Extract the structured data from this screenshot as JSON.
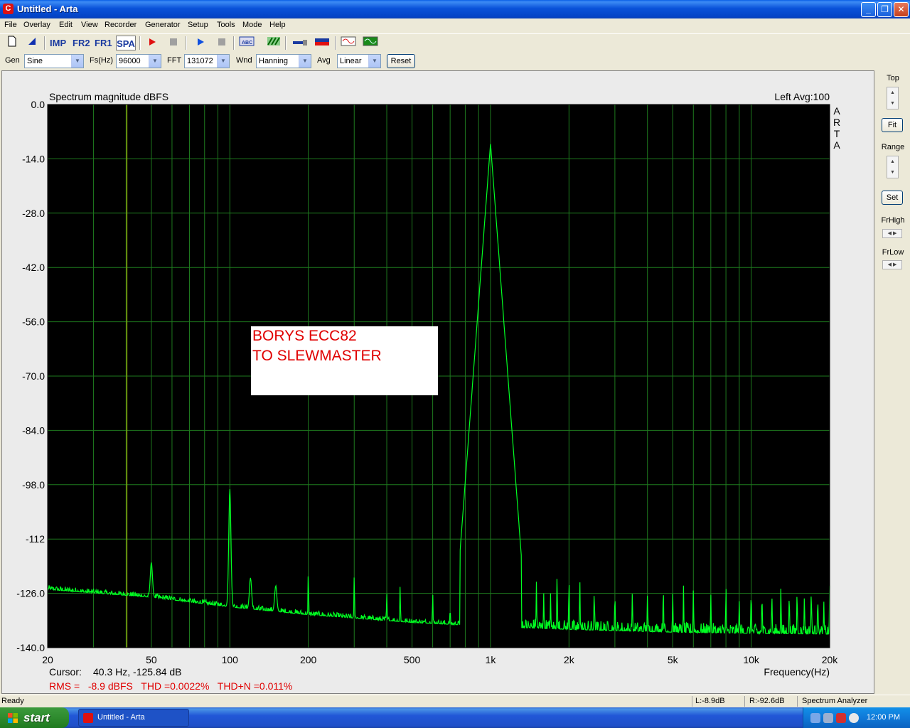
{
  "window": {
    "title": "Untitled - Arta",
    "icon": "arta-app-icon"
  },
  "menu": [
    "File",
    "Overlay",
    "Edit",
    "View",
    "Recorder",
    "Generator",
    "Setup",
    "Tools",
    "Mode",
    "Help"
  ],
  "toolbar": {
    "imp": "IMP",
    "fr2": "FR2",
    "fr1": "FR1",
    "spa": "SPA"
  },
  "controls": {
    "gen_label": "Gen",
    "gen_value": "Sine",
    "fs_label": "Fs(Hz)",
    "fs_value": "96000",
    "fft_label": "FFT",
    "fft_value": "131072",
    "wnd_label": "Wnd",
    "wnd_value": "Hanning",
    "avg_label": "Avg",
    "avg_value": "Linear",
    "reset_label": "Reset"
  },
  "side": {
    "top_label": "Top",
    "fit_label": "Fit",
    "range_label": "Range",
    "set_label": "Set",
    "frhigh_label": "FrHigh",
    "frlow_label": "FrLow"
  },
  "chart": {
    "title": "Spectrum magnitude dBFS",
    "channel_info": "Left  Avg:100",
    "watermark": [
      "A",
      "R",
      "T",
      "A"
    ],
    "xlabel": "Frequency(Hz)",
    "cursor_label": "Cursor:",
    "cursor_value": "40.3 Hz, -125.84 dB",
    "stats": "RMS =   -8.9 dBFS   THD =0.0022%   THD+N =0.011%",
    "annotation": [
      "BORYS ECC82",
      "TO SLEWMASTER"
    ],
    "colors": {
      "background": "#000000",
      "grid": "#1e7a1e",
      "trace": "#00ff22",
      "cursor": "#c8c800",
      "stats_text": "#e00000",
      "annotation_text": "#e00000"
    }
  },
  "chart_data": {
    "type": "line",
    "title": "Spectrum magnitude dBFS",
    "xlabel": "Frequency(Hz)",
    "ylabel": "",
    "xscale": "log",
    "xlim": [
      20,
      20000
    ],
    "ylim": [
      -140,
      0
    ],
    "grid": true,
    "x_ticks": [
      20,
      50,
      100,
      200,
      500,
      1000,
      2000,
      5000,
      10000,
      20000
    ],
    "x_tick_labels": [
      "20",
      "50",
      "100",
      "200",
      "500",
      "1k",
      "2k",
      "5k",
      "10k",
      "20k"
    ],
    "y_ticks": [
      0,
      -14,
      -28,
      -42,
      -56,
      -70,
      -84,
      -98,
      -112,
      -126,
      -140
    ],
    "y_tick_labels": [
      "0.0",
      "-14.0",
      "-28.0",
      "-42.0",
      "-56.0",
      "-70.0",
      "-84.0",
      "-98.0",
      "-112",
      "-126.0",
      "-140.0"
    ],
    "cursor": {
      "x": 40.3,
      "y": -125.84
    },
    "noise_floor": [
      [
        20,
        -125
      ],
      [
        50,
        -127
      ],
      [
        100,
        -129.5
      ],
      [
        200,
        -131.5
      ],
      [
        500,
        -133.5
      ],
      [
        1000,
        -134.5
      ],
      [
        2000,
        -135.3
      ],
      [
        5000,
        -136
      ],
      [
        10000,
        -136.3
      ],
      [
        20000,
        -136.5
      ]
    ],
    "peaks": [
      [
        50,
        -118
      ],
      [
        100,
        -99
      ],
      [
        120,
        -122
      ],
      [
        150,
        -124
      ],
      [
        200,
        -120
      ],
      [
        300,
        -121
      ],
      [
        400,
        -126
      ],
      [
        450,
        -124
      ],
      [
        600,
        -126
      ],
      [
        700,
        -130
      ],
      [
        800,
        -128
      ],
      [
        1000,
        -10
      ],
      [
        1100,
        -130
      ],
      [
        1200,
        -133
      ],
      [
        1300,
        -123
      ],
      [
        1500,
        -123
      ],
      [
        1600,
        -126
      ],
      [
        1700,
        -126
      ],
      [
        1800,
        -121
      ],
      [
        2000,
        -122
      ],
      [
        2200,
        -122
      ],
      [
        2500,
        -125
      ],
      [
        3000,
        -126
      ],
      [
        3500,
        -125
      ],
      [
        4000,
        -126
      ],
      [
        4600,
        -124
      ],
      [
        5000,
        -126
      ],
      [
        5500,
        -124
      ],
      [
        6000,
        -125
      ],
      [
        7000,
        -126
      ],
      [
        8000,
        -124
      ],
      [
        9000,
        -128
      ],
      [
        10000,
        -125
      ],
      [
        11000,
        -126
      ],
      [
        12000,
        -126
      ],
      [
        13000,
        -124
      ],
      [
        14000,
        -126
      ],
      [
        15000,
        -125
      ],
      [
        16000,
        -126
      ],
      [
        17000,
        -125
      ],
      [
        18000,
        -127
      ],
      [
        19000,
        -128
      ],
      [
        20000,
        -124
      ]
    ]
  },
  "status": {
    "ready": "Ready",
    "left_level": "L:-8.9dB",
    "right_level": "R:-92.6dB",
    "mode": "Spectrum Analyzer"
  },
  "taskbar": {
    "start": "start",
    "task": "Untitled - Arta",
    "clock": "12:00 PM"
  }
}
